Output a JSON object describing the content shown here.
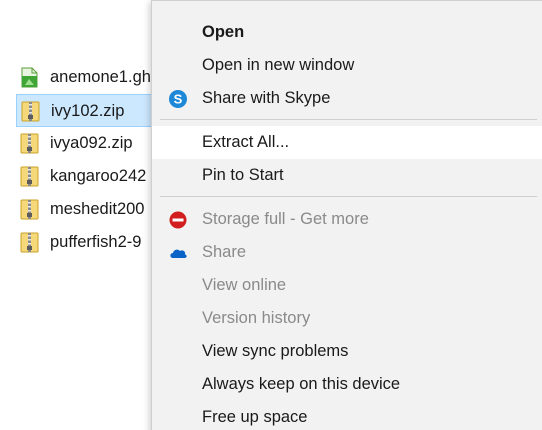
{
  "files": [
    {
      "name": "anemone1.gh",
      "icon": "green-file-icon"
    },
    {
      "name": "ivy102.zip",
      "icon": "zip-folder-icon",
      "selected": true
    },
    {
      "name": "ivya092.zip",
      "icon": "zip-folder-icon"
    },
    {
      "name": "kangaroo242",
      "icon": "zip-folder-icon"
    },
    {
      "name": "meshedit200",
      "icon": "zip-folder-icon"
    },
    {
      "name": "pufferfish2-9",
      "icon": "zip-folder-icon"
    }
  ],
  "menu": {
    "open": "Open",
    "open_new_window": "Open in new window",
    "share_skype": "Share with Skype",
    "extract_all": "Extract All...",
    "pin_to_start": "Pin to Start",
    "storage_full": "Storage full - Get more",
    "share": "Share",
    "view_online": "View online",
    "version_history": "Version history",
    "view_sync_problems": "View sync problems",
    "always_keep": "Always keep on this device",
    "free_up_space": "Free up space"
  },
  "colors": {
    "selection": "#cce8ff",
    "menu_bg": "#f2f2f2",
    "skype_blue": "#1e88d8",
    "onedrive_blue": "#0a64c8",
    "error_red": "#d21e1e",
    "zip_yellow": "#f2c94c"
  }
}
